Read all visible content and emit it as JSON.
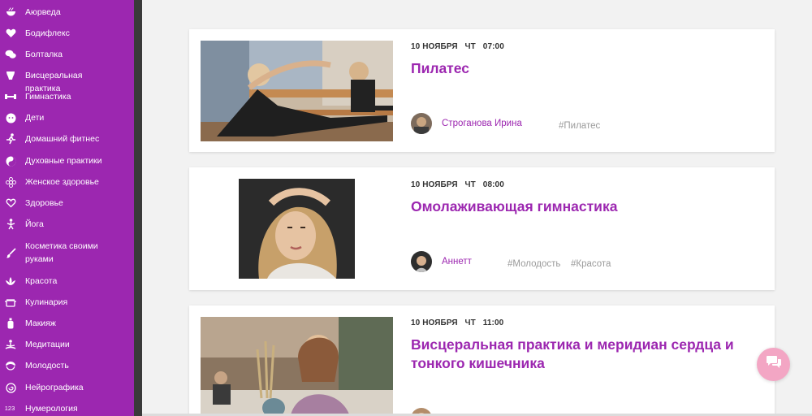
{
  "sidebar": {
    "items": [
      {
        "label": "Аюрведа",
        "icon": "bowl-icon"
      },
      {
        "label": "Бодифлекс",
        "icon": "heart-icon"
      },
      {
        "label": "Болталка",
        "icon": "chat-bubbles-icon"
      },
      {
        "label": "Висцеральная практика",
        "icon": "body-icon"
      },
      {
        "label": "Гимнастика",
        "icon": "dumbbell-icon"
      },
      {
        "label": "Дети",
        "icon": "child-icon"
      },
      {
        "label": "Домашний фитнес",
        "icon": "running-icon"
      },
      {
        "label": "Духовные практики",
        "icon": "yin-yang-icon"
      },
      {
        "label": "Женское здоровье",
        "icon": "flower-icon"
      },
      {
        "label": "Здоровье",
        "icon": "heart-outline-icon"
      },
      {
        "label": "Йога",
        "icon": "yoga-icon"
      },
      {
        "label": "Косметика своими руками",
        "icon": "brush-icon"
      },
      {
        "label": "Красота",
        "icon": "lotus-icon"
      },
      {
        "label": "Кулинария",
        "icon": "pot-icon"
      },
      {
        "label": "Макияж",
        "icon": "bottle-icon"
      },
      {
        "label": "Медитации",
        "icon": "meditation-icon"
      },
      {
        "label": "Молодость",
        "icon": "face-icon"
      },
      {
        "label": "Нейрографика",
        "icon": "spiral-icon"
      },
      {
        "label": "Нумерология",
        "icon": "numbers-icon",
        "icon_text": "123"
      }
    ]
  },
  "events": [
    {
      "date": "10 НОЯБРЯ",
      "weekday": "ЧТ",
      "time": "07:00",
      "title": "Пилатес",
      "author": "Строганова Ирина",
      "tags": [
        "#Пилатес"
      ]
    },
    {
      "date": "10 НОЯБРЯ",
      "weekday": "ЧТ",
      "time": "08:00",
      "title": "Омолаживающая гимнастика",
      "author": "Аннетт",
      "tags": [
        "#Молодость",
        "#Красота"
      ]
    },
    {
      "date": "10 НОЯБРЯ",
      "weekday": "ЧТ",
      "time": "11:00",
      "title": "Висцеральная практика и меридиан сердца и тонкого кишечника",
      "author": "",
      "tags": []
    }
  ],
  "chat": {
    "icon": "chat-icon"
  },
  "colors": {
    "accent": "#9c27b0",
    "chat": "#f3a6c4",
    "tag": "#9a9a9a"
  }
}
